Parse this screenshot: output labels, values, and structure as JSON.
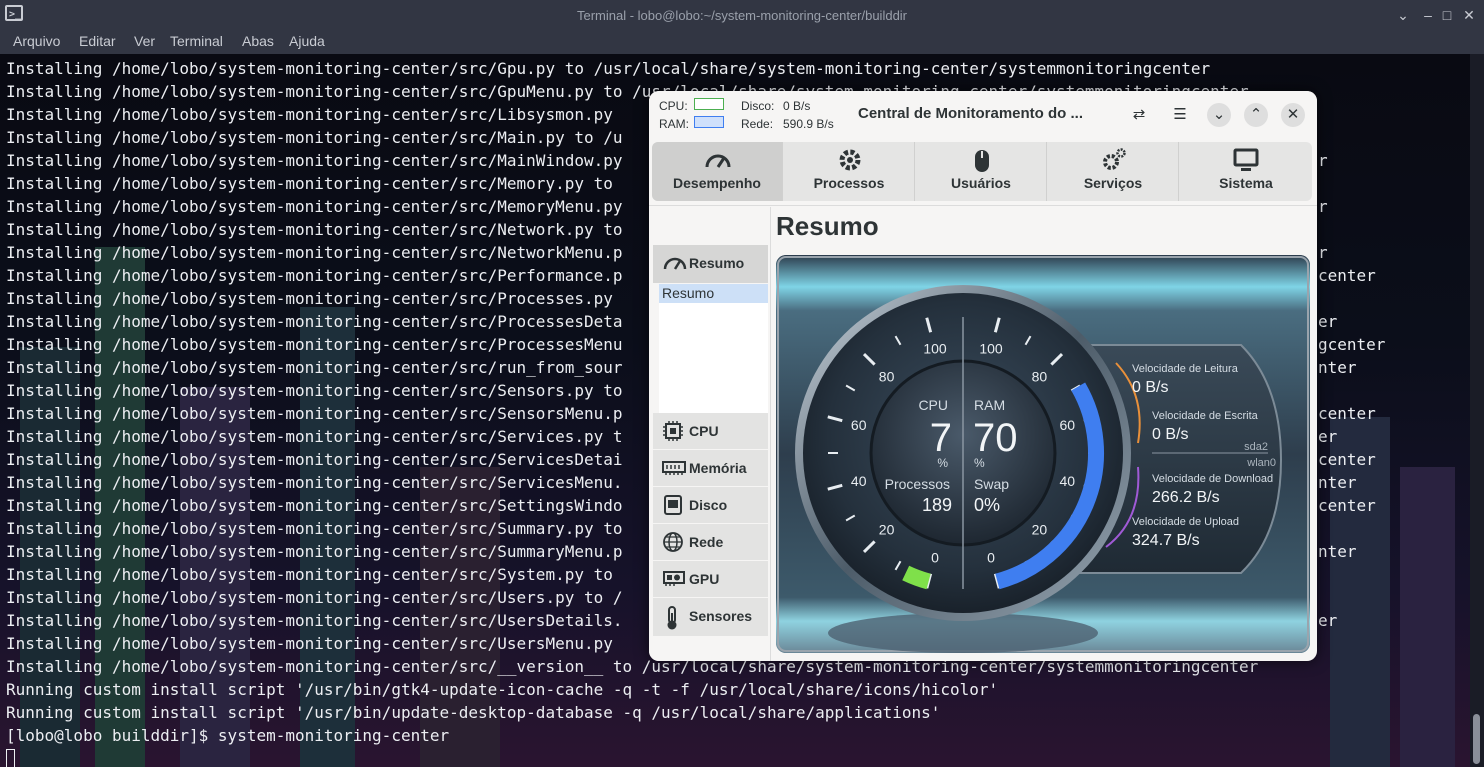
{
  "terminal": {
    "title": "Terminal - lobo@lobo:~/system-monitoring-center/builddir",
    "menu": [
      "Arquivo",
      "Editar",
      "Ver",
      "Terminal",
      "Abas",
      "Ajuda"
    ],
    "lines": [
      "Installing /home/lobo/system-monitoring-center/src/Gpu.py to /usr/local/share/system-monitoring-center/systemmonitoringcenter",
      "Installing /home/lobo/system-monitoring-center/src/GpuMenu.py to /usr/local/share/system-monitoring-center/systemmonitoringcenter",
      "Installing /home/lobo/system-monitoring-center/src/Libsysmon.py",
      "Installing /home/lobo/system-monitoring-center/src/Main.py to /u",
      "Installing /home/lobo/system-monitoring-center/src/MainWindow.py",
      "Installing /home/lobo/system-monitoring-center/src/Memory.py to",
      "Installing /home/lobo/system-monitoring-center/src/MemoryMenu.py",
      "Installing /home/lobo/system-monitoring-center/src/Network.py to",
      "Installing /home/lobo/system-monitoring-center/src/NetworkMenu.p",
      "Installing /home/lobo/system-monitoring-center/src/Performance.p",
      "Installing /home/lobo/system-monitoring-center/src/Processes.py",
      "Installing /home/lobo/system-monitoring-center/src/ProcessesDeta",
      "Installing /home/lobo/system-monitoring-center/src/ProcessesMenu",
      "Installing /home/lobo/system-monitoring-center/src/run_from_sour",
      "Installing /home/lobo/system-monitoring-center/src/Sensors.py to",
      "Installing /home/lobo/system-monitoring-center/src/SensorsMenu.p",
      "Installing /home/lobo/system-monitoring-center/src/Services.py t",
      "Installing /home/lobo/system-monitoring-center/src/ServicesDetai",
      "Installing /home/lobo/system-monitoring-center/src/ServicesMenu.",
      "Installing /home/lobo/system-monitoring-center/src/SettingsWindo",
      "Installing /home/lobo/system-monitoring-center/src/Summary.py to",
      "Installing /home/lobo/system-monitoring-center/src/SummaryMenu.p",
      "Installing /home/lobo/system-monitoring-center/src/System.py to",
      "Installing /home/lobo/system-monitoring-center/src/Users.py to /",
      "Installing /home/lobo/system-monitoring-center/src/UsersDetails.",
      "Installing /home/lobo/system-monitoring-center/src/UsersMenu.py",
      "Installing /home/lobo/system-monitoring-center/src/__version__ to /usr/local/share/system-monitoring-center/systemmonitoringcenter",
      "Running custom install script '/usr/bin/gtk4-update-icon-cache -q -t -f /usr/local/share/icons/hicolor'",
      "Running custom install script '/usr/bin/update-desktop-database -q /usr/local/share/applications'",
      "[lobo@lobo builddir]$ system-monitoring-center"
    ],
    "right_fragments": [
      "r",
      "r",
      "r",
      "center",
      "er",
      "gcenter",
      "nter",
      "center",
      "er",
      "center",
      "nter",
      "center",
      "nter",
      "er",
      "er",
      "er"
    ]
  },
  "app": {
    "title": "Central de Monitoramento do ...",
    "header": {
      "cpu_label": "CPU:",
      "ram_label": "RAM:",
      "disk_label": "Disco:",
      "disk_value": "0 B/s",
      "net_label": "Rede:",
      "net_value": "590.9 B/s"
    },
    "tabs": [
      "Desempenho",
      "Processos",
      "Usuários",
      "Serviços",
      "Sistema"
    ],
    "sidebar": {
      "items": [
        "Resumo",
        "CPU",
        "Memória",
        "Disco",
        "Rede",
        "GPU",
        "Sensores"
      ],
      "sub_item": "Resumo"
    },
    "section_title": "Resumo",
    "gauge": {
      "cpu_label": "CPU",
      "cpu_value": "7",
      "cpu_unit": "%",
      "ram_label": "RAM",
      "ram_value": "70",
      "ram_unit": "%",
      "proc_label": "Processos",
      "proc_value": "189",
      "swap_label": "Swap",
      "swap_value": "0%",
      "cpu_percent": 7,
      "ram_percent": 70,
      "left_ticks": [
        "100",
        "80",
        "60",
        "40",
        "20",
        "0"
      ],
      "right_ticks": [
        "100",
        "80",
        "60",
        "40",
        "20",
        "0"
      ],
      "read_label": "Velocidade de Leitura",
      "read_value": "0 B/s",
      "write_label": "Velocidade de Escrita",
      "write_value": "0 B/s",
      "disk_name": "sda2",
      "net_name": "wlan0",
      "download_label": "Velocidade de Download",
      "download_value": "266.2 B/s",
      "upload_label": "Velocidade de Upload",
      "upload_value": "324.7 B/s"
    },
    "colors": {
      "cpu_arc": "#7fe04a",
      "ram_arc": "#3f7ef0",
      "read_arc": "#e9903a",
      "write_arc": "#e9903a",
      "net_arc": "#a05ad6"
    }
  }
}
